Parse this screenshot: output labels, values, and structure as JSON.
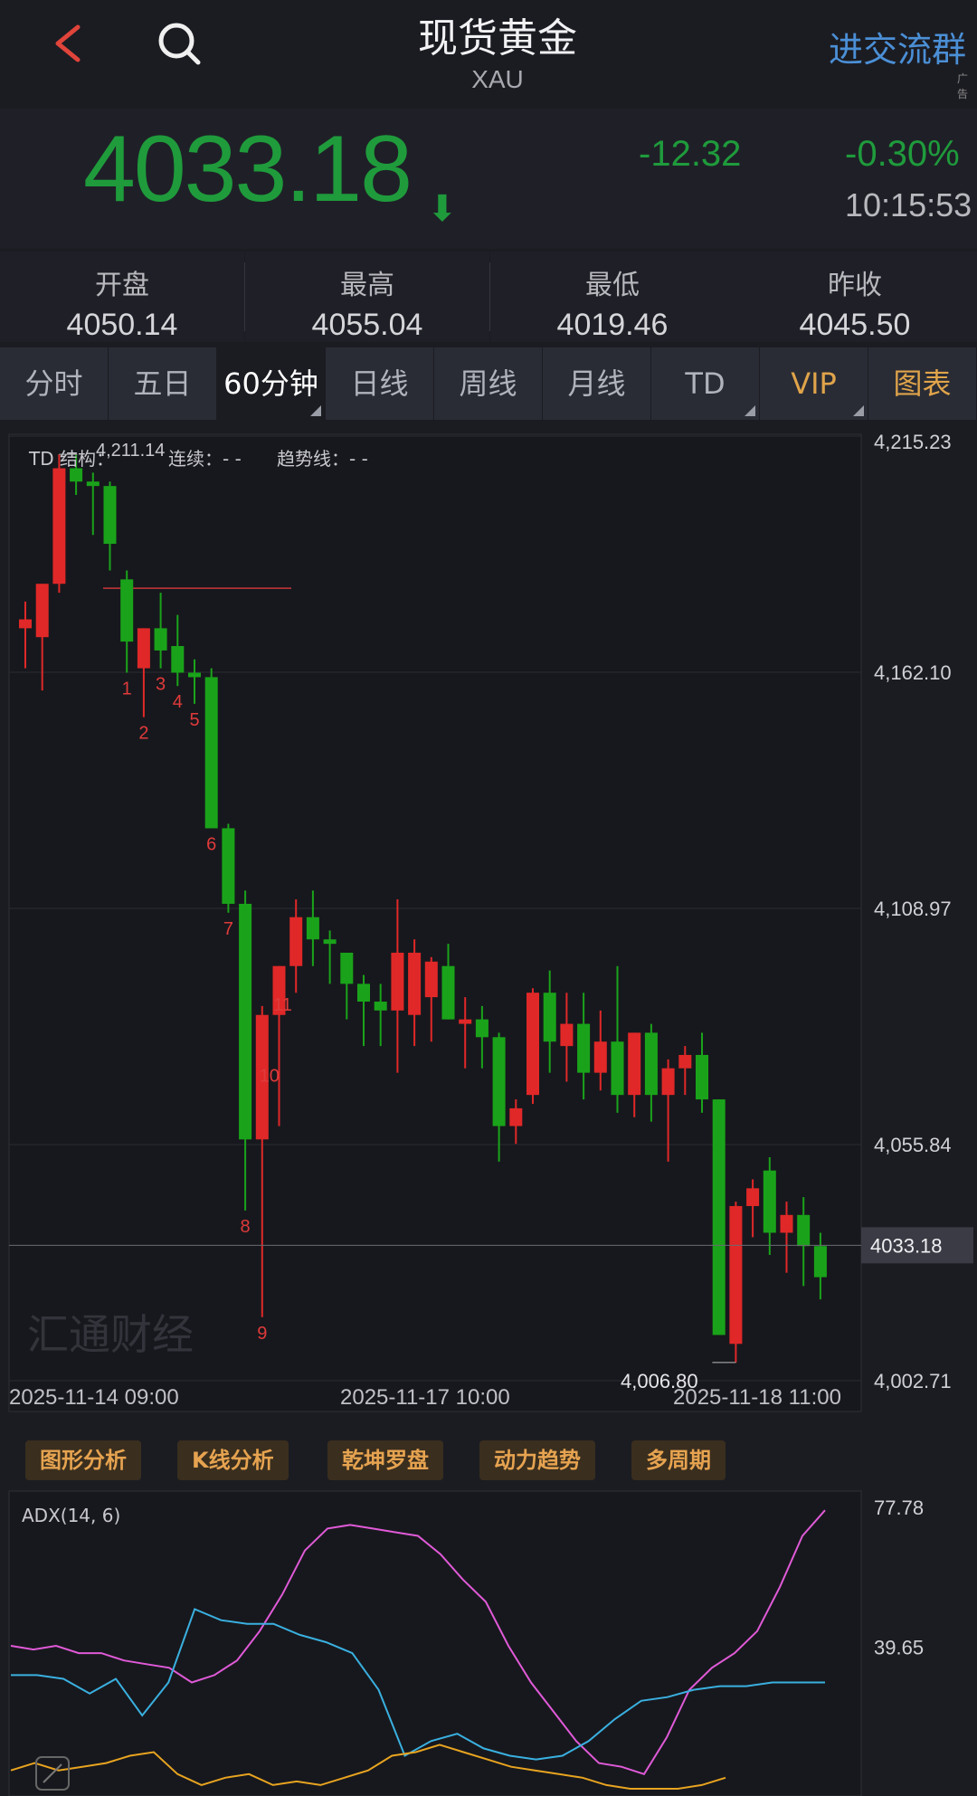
{
  "header": {
    "title": "现货黄金",
    "subtitle": "XAU",
    "join_label": "进交流群",
    "ad_label": "广告",
    "back_icon": "back-arrow-icon",
    "search_icon": "search-icon"
  },
  "quote": {
    "price": "4033.18",
    "change": "-12.32",
    "change_pct": "-0.30%",
    "time": "10:15:53",
    "direction_glyph": "⬇",
    "color_down": "#1f9b3c"
  },
  "stats": [
    {
      "label": "开盘",
      "value": "4050.14"
    },
    {
      "label": "最高",
      "value": "4055.04"
    },
    {
      "label": "最低",
      "value": "4019.46"
    },
    {
      "label": "昨收",
      "value": "4045.50"
    }
  ],
  "tabs": [
    {
      "label": "分时"
    },
    {
      "label": "五日"
    },
    {
      "label": "60分钟"
    },
    {
      "label": "日线"
    },
    {
      "label": "周线"
    },
    {
      "label": "月线"
    },
    {
      "label": "TD"
    },
    {
      "label": "VIP"
    },
    {
      "label": "图表"
    }
  ],
  "main_chart": {
    "legend": {
      "td": "TD 结构：",
      "lianxu": "连续：- -",
      "trend": "趋势线：- -"
    },
    "high_label": "4,211.14",
    "low_label": "4,006.80",
    "current_price_tag": "4033.18",
    "watermark": "汇通财经",
    "x_labels": [
      "2025-11-14 09:00",
      "2025-11-17 10:00",
      "2025-11-18 11:00"
    ]
  },
  "tools": [
    "图形分析",
    "K线分析",
    "乾坤罗盘",
    "动力趋势",
    "多周期"
  ],
  "adx": {
    "label": "ADX(14, 6)",
    "y_labels": [
      "77.78",
      "39.65"
    ]
  },
  "chart_data": [
    {
      "type": "candlestick",
      "y_axis_labels": [
        "4,215.23",
        "4,162.10",
        "4,108.97",
        "4,055.84",
        "4,002.71"
      ],
      "ylim": [
        4002.71,
        4215.23
      ],
      "x_tick_labels": [
        "2025-11-14 09:00",
        "2025-11-17 10:00",
        "2025-11-18 11:00"
      ],
      "colors": {
        "up": "#e02828",
        "down": "#1aa31a"
      },
      "candles": [
        {
          "o": 4172,
          "h": 4178,
          "l": 4163,
          "c": 4174
        },
        {
          "o": 4170,
          "h": 4182,
          "l": 4158,
          "c": 4182
        },
        {
          "o": 4182,
          "h": 4211.14,
          "l": 4180,
          "c": 4208
        },
        {
          "o": 4208,
          "h": 4211,
          "l": 4202,
          "c": 4205
        },
        {
          "o": 4205,
          "h": 4207,
          "l": 4193,
          "c": 4204
        },
        {
          "o": 4204,
          "h": 4205,
          "l": 4185,
          "c": 4191
        },
        {
          "o": 4183,
          "h": 4185,
          "l": 4162,
          "c": 4169
        },
        {
          "o": 4163,
          "h": 4172,
          "l": 4152,
          "c": 4172
        },
        {
          "o": 4172,
          "h": 4180,
          "l": 4163,
          "c": 4167
        },
        {
          "o": 4168,
          "h": 4175,
          "l": 4159,
          "c": 4162
        },
        {
          "o": 4162,
          "h": 4165,
          "l": 4155,
          "c": 4161
        },
        {
          "o": 4161,
          "h": 4163,
          "l": 4127,
          "c": 4127
        },
        {
          "o": 4127,
          "h": 4128,
          "l": 4108,
          "c": 4110
        },
        {
          "o": 4110,
          "h": 4113,
          "l": 4041,
          "c": 4057
        },
        {
          "o": 4057,
          "h": 4087,
          "l": 4017,
          "c": 4085
        },
        {
          "o": 4085,
          "h": 4096,
          "l": 4060,
          "c": 4096
        },
        {
          "o": 4096,
          "h": 4111,
          "l": 4090,
          "c": 4107
        },
        {
          "o": 4107,
          "h": 4113,
          "l": 4096,
          "c": 4102
        },
        {
          "o": 4102,
          "h": 4104,
          "l": 4092,
          "c": 4101
        },
        {
          "o": 4099,
          "h": 4099,
          "l": 4084,
          "c": 4092
        },
        {
          "o": 4092,
          "h": 4094,
          "l": 4078,
          "c": 4088
        },
        {
          "o": 4088,
          "h": 4092,
          "l": 4078,
          "c": 4086
        },
        {
          "o": 4086,
          "h": 4111,
          "l": 4072,
          "c": 4099
        },
        {
          "o": 4085,
          "h": 4102,
          "l": 4078,
          "c": 4099
        },
        {
          "o": 4089,
          "h": 4098,
          "l": 4079,
          "c": 4097
        },
        {
          "o": 4096,
          "h": 4101,
          "l": 4084,
          "c": 4084
        },
        {
          "o": 4083,
          "h": 4089,
          "l": 4073,
          "c": 4084
        },
        {
          "o": 4084,
          "h": 4087,
          "l": 4073,
          "c": 4080
        },
        {
          "o": 4080,
          "h": 4081,
          "l": 4052,
          "c": 4060
        },
        {
          "o": 4060,
          "h": 4066,
          "l": 4056,
          "c": 4064
        },
        {
          "o": 4067,
          "h": 4091,
          "l": 4065,
          "c": 4090
        },
        {
          "o": 4090,
          "h": 4095,
          "l": 4072,
          "c": 4079
        },
        {
          "o": 4078,
          "h": 4090,
          "l": 4070,
          "c": 4083
        },
        {
          "o": 4083,
          "h": 4090,
          "l": 4066,
          "c": 4072
        },
        {
          "o": 4072,
          "h": 4086,
          "l": 4068,
          "c": 4079
        },
        {
          "o": 4079,
          "h": 4096,
          "l": 4063,
          "c": 4067
        },
        {
          "o": 4067,
          "h": 4081,
          "l": 4062,
          "c": 4081
        },
        {
          "o": 4081,
          "h": 4083,
          "l": 4061,
          "c": 4067
        },
        {
          "o": 4067,
          "h": 4075,
          "l": 4052,
          "c": 4073
        },
        {
          "o": 4073,
          "h": 4078,
          "l": 4067,
          "c": 4076
        },
        {
          "o": 4076,
          "h": 4081,
          "l": 4063,
          "c": 4066
        },
        {
          "o": 4066,
          "h": 4066,
          "l": 4013,
          "c": 4013
        },
        {
          "o": 4011,
          "h": 4043,
          "l": 4006.8,
          "c": 4042
        },
        {
          "o": 4042,
          "h": 4048,
          "l": 4035,
          "c": 4046
        },
        {
          "o": 4050,
          "h": 4053,
          "l": 4031,
          "c": 4036
        },
        {
          "o": 4036,
          "h": 4043,
          "l": 4027,
          "c": 4040
        },
        {
          "o": 4040,
          "h": 4044,
          "l": 4024,
          "c": 4033
        },
        {
          "o": 4033,
          "h": 4036,
          "l": 4021,
          "c": 4026
        }
      ],
      "td_labels": [
        {
          "index": 6,
          "text": "1"
        },
        {
          "index": 7,
          "text": "2"
        },
        {
          "index": 8,
          "text": "3"
        },
        {
          "index": 9,
          "text": "4"
        },
        {
          "index": 10,
          "text": "5"
        },
        {
          "index": 11,
          "text": "6"
        },
        {
          "index": 12,
          "text": "7"
        },
        {
          "index": 13,
          "text": "8"
        },
        {
          "index": 14,
          "text": "9"
        },
        {
          "index": 14,
          "text": "10"
        },
        {
          "index": 15,
          "text": "11"
        }
      ],
      "current_price": 4033.18,
      "resistance_line": 4181
    },
    {
      "type": "line",
      "title": "ADX(14, 6)",
      "y_axis_labels": [
        "77.78",
        "39.65"
      ],
      "ylim": [
        0,
        77.78
      ],
      "series": [
        {
          "color": "#e05ad8",
          "values": [
            40,
            39,
            40,
            38,
            38,
            36,
            35,
            34,
            30,
            32,
            36,
            44,
            54,
            66,
            72,
            73,
            72,
            71,
            70,
            65,
            58,
            52,
            40,
            30,
            22,
            14,
            8,
            7,
            5,
            15,
            28,
            34,
            38,
            44,
            56,
            70,
            77
          ]
        },
        {
          "color": "#3ab0e0",
          "values": [
            32,
            32,
            31,
            27,
            31,
            21,
            30,
            50,
            47,
            46,
            46,
            43,
            41,
            38,
            28,
            10,
            14,
            16,
            12,
            10,
            9,
            10,
            14,
            20,
            25,
            26,
            28,
            29,
            29,
            30,
            30,
            30
          ]
        },
        {
          "color": "#e8a420",
          "values": [
            6,
            8,
            6,
            7,
            8,
            10,
            11,
            5,
            2,
            4,
            5,
            2,
            3,
            2,
            4,
            6,
            10,
            11,
            13,
            11,
            9,
            7,
            6,
            5,
            4,
            2,
            1,
            1,
            1,
            2,
            4
          ]
        }
      ]
    }
  ]
}
